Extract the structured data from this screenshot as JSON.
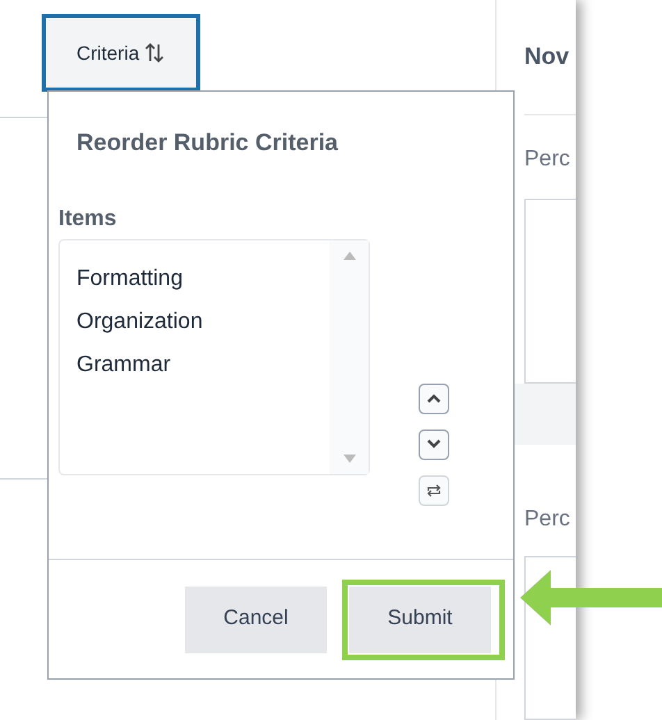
{
  "toolbar": {
    "criteria_button": {
      "label": "Criteria"
    }
  },
  "right_panel": {
    "heading": "Nov",
    "labels": [
      "Perc",
      "Perc"
    ]
  },
  "popup": {
    "title": "Reorder Rubric Criteria",
    "items_label": "Items",
    "items": [
      "Formatting",
      "Organization",
      "Grammar"
    ],
    "buttons": [
      {
        "label": "Cancel",
        "highlighted": false
      },
      {
        "label": "Submit",
        "highlighted": true
      }
    ]
  }
}
